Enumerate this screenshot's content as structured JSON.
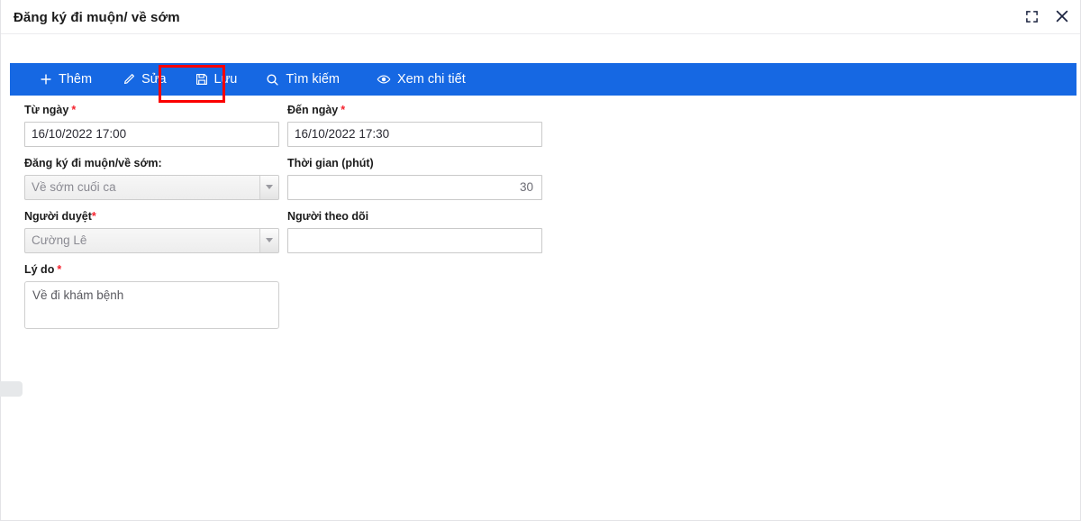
{
  "window": {
    "title": "Đăng ký đi muộn/ về sớm",
    "buttons": [
      {
        "name": "fullscreen-button",
        "icon": "fullscreen-icon",
        "label": ""
      },
      {
        "name": "close-button",
        "icon": "close-icon",
        "label": ""
      }
    ]
  },
  "toolbar": {
    "accent_color": "#1668e3",
    "highlight_color": "#fb0000",
    "highlighted_item": "Lưu",
    "items": [
      {
        "icon": "plus-icon",
        "label": "Thêm"
      },
      {
        "icon": "pencil-icon",
        "label": "Sửa"
      },
      {
        "icon": "save-icon",
        "label": "Lưu"
      },
      {
        "icon": "search-icon",
        "label": "Tìm kiếm"
      },
      {
        "icon": "eye-icon",
        "label": "Xem chi tiết"
      }
    ]
  },
  "form": {
    "from_date": {
      "label": "Từ ngày",
      "required": "*",
      "value": "16/10/2022 17:00",
      "placeholder": ""
    },
    "to_date": {
      "label": "Đến ngày",
      "required": "*",
      "value": "16/10/2022 17:30",
      "placeholder": ""
    },
    "register_type": {
      "label": "Đăng ký đi muộn/về sớm:",
      "value": "Về sớm cuối ca"
    },
    "duration": {
      "label": "Thời gian (phút)",
      "value": "30",
      "placeholder": ""
    },
    "approver": {
      "label": "Người duyệt",
      "required": "*",
      "value": "Cường Lê"
    },
    "follower": {
      "label": "Người theo dõi",
      "value": "",
      "placeholder": ""
    },
    "reason": {
      "label": "Lý do",
      "required": "*",
      "value": "Về đi khám bệnh",
      "placeholder": ""
    }
  }
}
